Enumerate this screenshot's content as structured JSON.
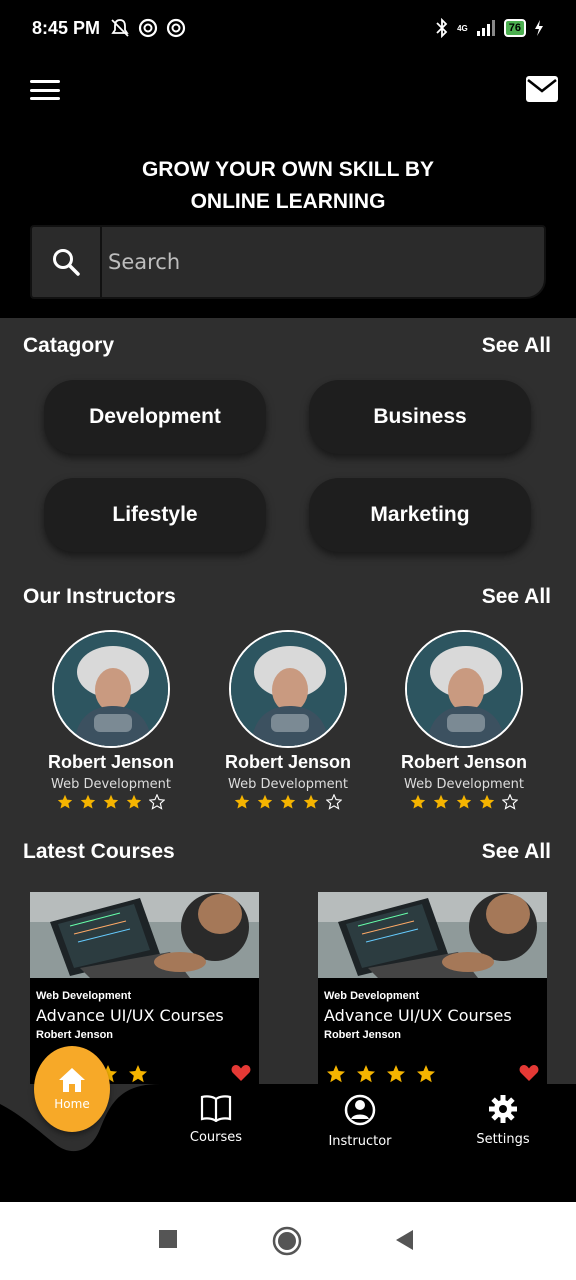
{
  "status_bar": {
    "time": "8:45 PM",
    "network": "4G",
    "battery": "76"
  },
  "header": {
    "headline_line1": "GROW YOUR OWN SKILL BY",
    "headline_line2": "ONLINE LEARNING",
    "search": {
      "placeholder": "Search"
    }
  },
  "category": {
    "title": "Catagory",
    "see_all": "See All",
    "items": [
      {
        "label": "Development"
      },
      {
        "label": "Business"
      },
      {
        "label": "Lifestyle"
      },
      {
        "label": "Marketing"
      }
    ]
  },
  "instructors": {
    "title": "Our Instructors",
    "see_all": "See All",
    "items": [
      {
        "name": "Robert Jenson",
        "role": "Web Development",
        "rating": 4
      },
      {
        "name": "Robert Jenson",
        "role": "Web Development",
        "rating": 4
      },
      {
        "name": "Robert Jenson",
        "role": "Web Development",
        "rating": 4
      }
    ]
  },
  "courses": {
    "title": "Latest Courses",
    "see_all": "See All",
    "items": [
      {
        "category": "Web Development",
        "title": "Advance UI/UX Courses",
        "author": "Robert Jenson",
        "rating": 4
      },
      {
        "category": "Web Development",
        "title": "Advance UI/UX Courses",
        "author": "Robert Jenson",
        "rating": 4
      }
    ]
  },
  "bottom_nav": {
    "home": "Home",
    "courses": "Courses",
    "instructor": "Instructor",
    "settings": "Settings"
  },
  "colors": {
    "accent": "#f7a928",
    "star": "#f5b400",
    "heart": "#e53935",
    "panel": "#2f2f2f"
  }
}
